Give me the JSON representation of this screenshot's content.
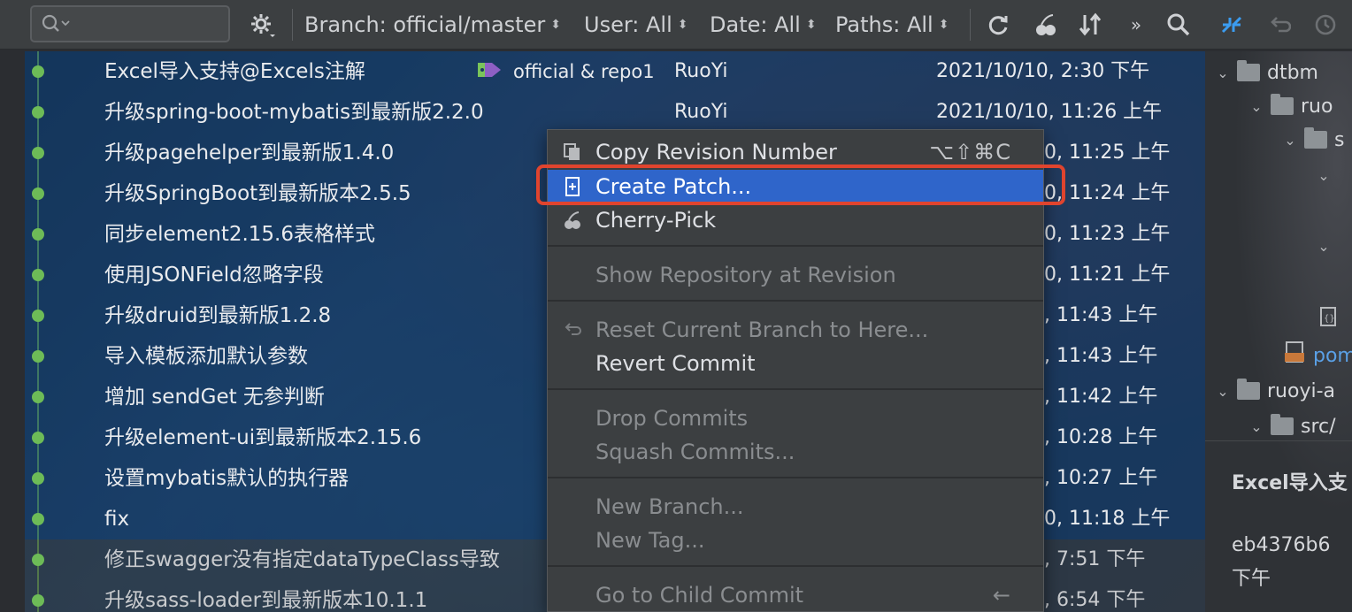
{
  "toolbar": {
    "branch": "Branch: official/master",
    "user": "User: All",
    "date": "Date: All",
    "paths": "Paths: All",
    "more": "»"
  },
  "log": {
    "rows": [
      {
        "subject": "Excel导入支持@Excels注解",
        "tag": "official & repo1",
        "author": "RuoYi",
        "date": "2021/10/10, 2:30 下午"
      },
      {
        "subject": "升级spring-boot-mybatis到最新版2.2.0",
        "author": "RuoYi",
        "date": "2021/10/10, 11:26 上午"
      },
      {
        "subject": "升级pagehelper到最新版1.4.0",
        "date": "0, 11:25 上午"
      },
      {
        "subject": "升级SpringBoot到最新版本2.5.5",
        "date": "0, 11:24 上午"
      },
      {
        "subject": "同步element2.15.6表格样式",
        "date": "0, 11:23 上午"
      },
      {
        "subject": "使用JSONField忽略字段",
        "date": "0, 11:21 上午"
      },
      {
        "subject": "升级druid到最新版1.2.8",
        "date": ", 11:43 上午"
      },
      {
        "subject": "导入模板添加默认参数",
        "date": ", 11:43 上午"
      },
      {
        "subject": "增加 sendGet 无参判断",
        "date": ", 11:42 上午"
      },
      {
        "subject": "升级element-ui到最新版本2.15.6",
        "date": ", 10:28 上午"
      },
      {
        "subject": "设置mybatis默认的执行器",
        "date": ", 10:27 上午"
      },
      {
        "subject": "fix",
        "date": "0, 11:18 上午"
      },
      {
        "subject": "修正swagger没有指定dataTypeClass导致",
        "date": ", 7:51 下午"
      },
      {
        "subject": "升级sass-loader到最新版本10.1.1",
        "date": ", 6:54 下午"
      }
    ]
  },
  "context_menu": {
    "copy_revision": "Copy Revision Number",
    "copy_revision_shortcut": "⌥⇧⌘C",
    "create_patch": "Create Patch...",
    "cherry_pick": "Cherry-Pick",
    "show_repository": "Show Repository at Revision",
    "reset_branch": "Reset Current Branch to Here...",
    "revert_commit": "Revert Commit",
    "drop_commits": "Drop Commits",
    "squash_commits": "Squash Commits...",
    "new_branch": "New Branch...",
    "new_tag": "New Tag...",
    "go_to_child": "Go to Child Commit",
    "go_to_child_shortcut": "←"
  },
  "right_panel": {
    "tree": {
      "dtbm": "dtbm",
      "ruo": "ruo",
      "s": "s",
      "pom": "pom",
      "ruoyi_a": "ruoyi-a",
      "src": "src/"
    },
    "detail_title": "Excel导入支",
    "detail_hash": "eb4376b6",
    "detail_time": "下午"
  },
  "colors": {
    "accent": "#2f65ca",
    "graph": "#6dbb57",
    "highlight": "#e0442e"
  }
}
